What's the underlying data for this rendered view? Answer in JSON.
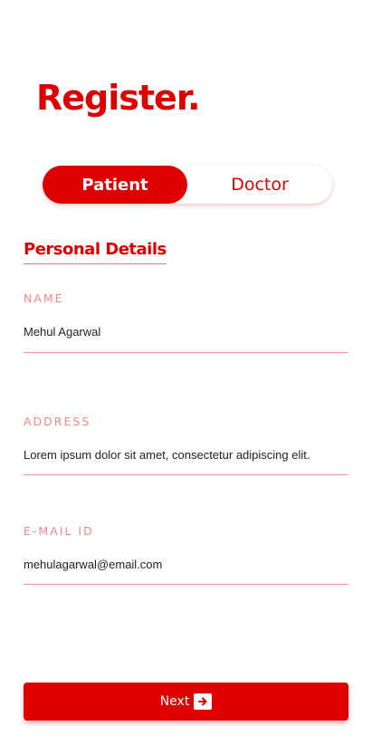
{
  "title": "Register.",
  "role_toggle": {
    "options": [
      "Patient",
      "Doctor"
    ],
    "selected": "Patient"
  },
  "section": {
    "title": "Personal Details"
  },
  "fields": {
    "name": {
      "label": "NAME",
      "value": "Mehul Agarwal"
    },
    "address": {
      "label": "ADDRESS",
      "value": "Lorem ipsum dolor sit amet, consectetur adipiscing elit."
    },
    "email": {
      "label": "E-MAIL ID",
      "value": "mehulagarwal@email.com"
    }
  },
  "next_button": {
    "label": "Next",
    "icon": "arrow-right-icon"
  },
  "colors": {
    "accent": "#dc0000",
    "label": "#f08a8a",
    "underline": "#e89a9a",
    "text": "#222222"
  }
}
